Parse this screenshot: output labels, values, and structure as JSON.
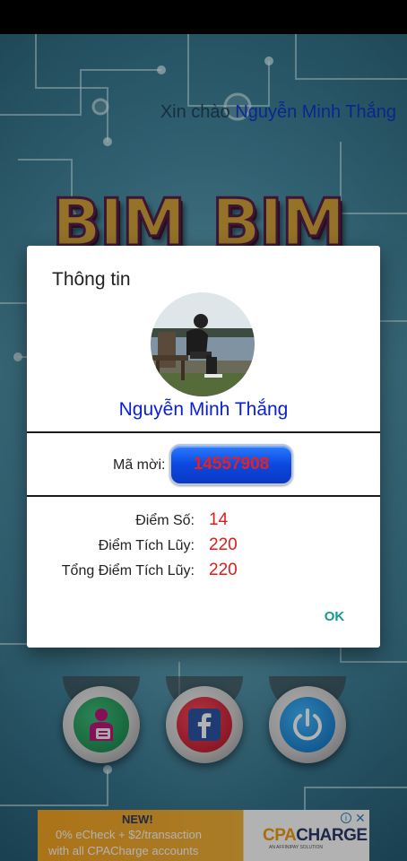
{
  "background": {
    "greeting_prefix": "Xin chào",
    "greeting_name": "Nguyễn Minh Thắng",
    "logo_word_1": "BIM",
    "logo_word_2": "BIM",
    "buttons": [
      "profile-icon",
      "facebook-icon",
      "power-icon"
    ]
  },
  "dialog": {
    "title": "Thông tin",
    "user_name": "Nguyễn Minh Thắng",
    "invite_label": "Mã mời:",
    "invite_code": "14557908",
    "stats": [
      {
        "label": "Điểm Số:",
        "value": "14"
      },
      {
        "label": "Điểm Tích Lũy:",
        "value": "220"
      },
      {
        "label": "Tổng Điểm Tích Lũy:",
        "value": "220"
      }
    ],
    "ok_label": "OK"
  },
  "ad": {
    "headline": "NEW!",
    "line1": "0% eCheck + $2/transaction",
    "line2": "with all CPACharge accounts",
    "brand_a": "CPA",
    "brand_b": "CHARGE",
    "brand_sub": "AN AFFINIPAY SOLUTION",
    "info_icon": "i",
    "close_icon": "✕"
  },
  "colors": {
    "accent_link": "#0a1fd6",
    "value_red": "#e01b1b",
    "ok_teal": "#159a8c",
    "code_button_blue": "#0b48e0"
  }
}
